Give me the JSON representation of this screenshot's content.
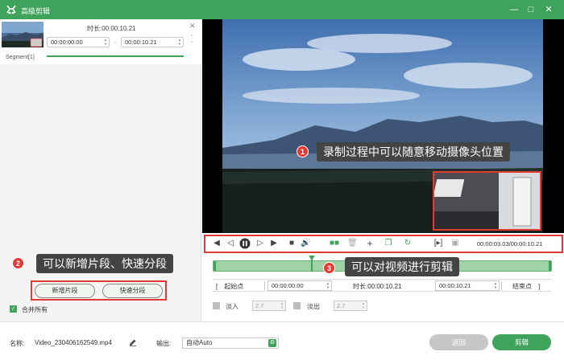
{
  "window": {
    "title": "高级剪辑",
    "brand_color": "#3fa35b"
  },
  "segment": {
    "duration_label": "时长:",
    "duration_value": "00:00:10.21",
    "start_time": "00:00:00.00",
    "end_time": "00:00:10.21",
    "name": "Segment[1]"
  },
  "annotations": [
    {
      "number": "1",
      "text": "录制过程中可以随意移动摄像头位置"
    },
    {
      "number": "2",
      "text": "可以新增片段、快速分段"
    },
    {
      "number": "3",
      "text": "可以对视频进行剪辑"
    }
  ],
  "left_actions": {
    "add_segment": "新增片段",
    "quick_split": "快速分段",
    "merge_all": "合并所有"
  },
  "player": {
    "timecode": "00:00:03.03/00:00:10.21",
    "playhead_fraction": 0.296
  },
  "range": {
    "start_label": "起始点",
    "start_value": "00:00:00.00",
    "duration_label": "时长:",
    "duration_value": "00:00:10.21",
    "end_label": "结束点"
  },
  "fade": {
    "fade_in_label": "淡入",
    "fade_in_value": "2.7",
    "fade_out_label": "淡出",
    "fade_out_value": "2.7"
  },
  "footer": {
    "name_label": "名称:",
    "file_name": "Video_230406162549.mp4",
    "output_label": "输出:",
    "output_value": "自动Auto",
    "back_button": "返回",
    "cut_button": "剪辑"
  },
  "icons": [
    "app-logo-icon",
    "minimize-icon",
    "maximize-icon",
    "close-icon",
    "edit-icon",
    "gear-icon"
  ]
}
